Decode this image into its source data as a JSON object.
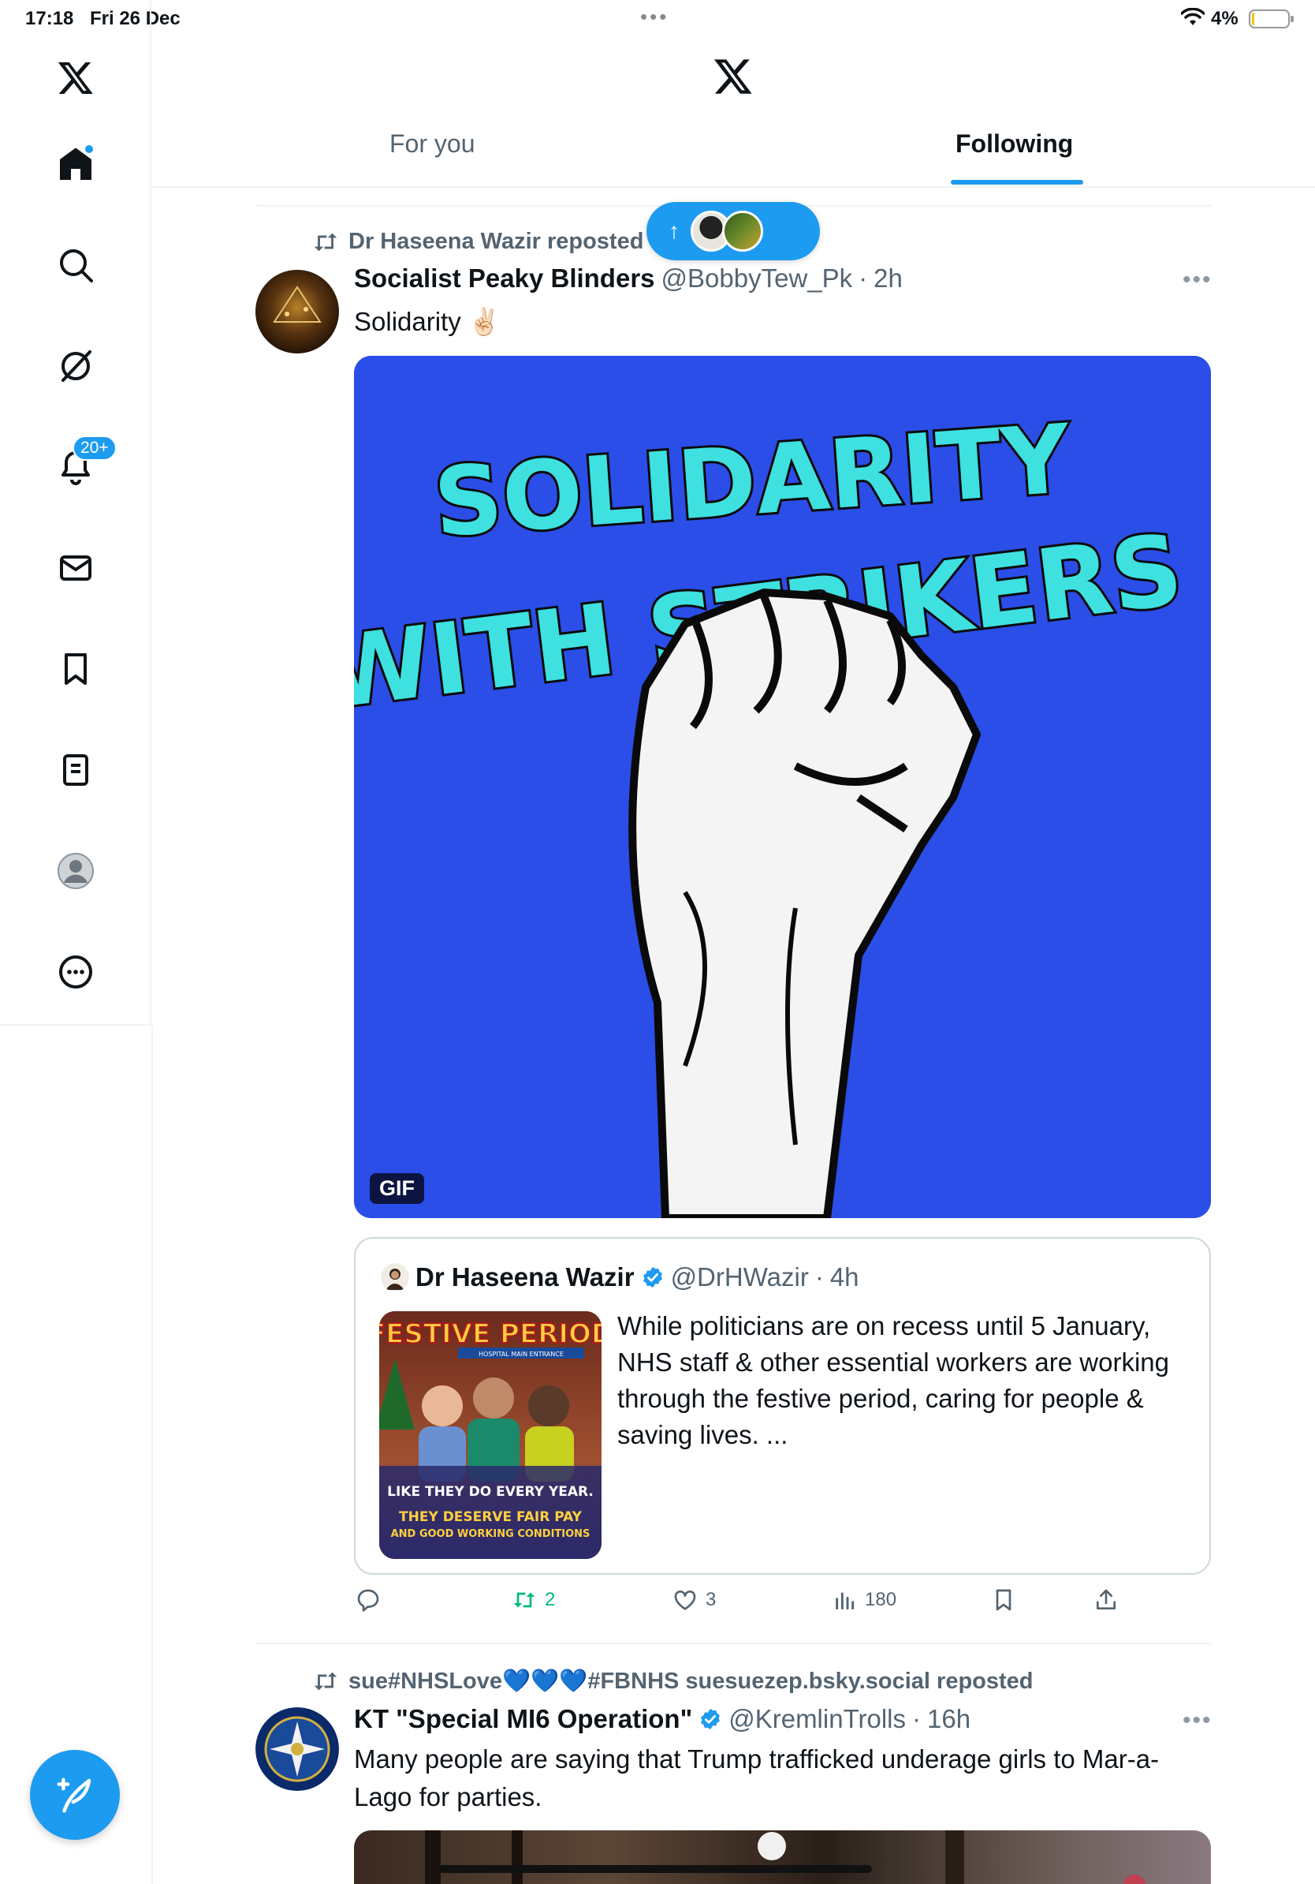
{
  "status": {
    "time": "17:18",
    "date": "Fri 26 Dec",
    "battery_pct": "4%",
    "battery_level": 0.04
  },
  "sidebar": {
    "items": [
      {
        "name": "logo",
        "icon": "x-logo-icon"
      },
      {
        "name": "home",
        "icon": "home-icon",
        "dot": true
      },
      {
        "name": "explore",
        "icon": "search-icon"
      },
      {
        "name": "grok",
        "icon": "grok-icon"
      },
      {
        "name": "notifications",
        "icon": "bell-icon",
        "badge": "20+"
      },
      {
        "name": "messages",
        "icon": "mail-icon"
      },
      {
        "name": "bookmarks",
        "icon": "bookmark-icon"
      },
      {
        "name": "lists",
        "icon": "list-icon"
      },
      {
        "name": "profile",
        "icon": "avatar-icon"
      },
      {
        "name": "more",
        "icon": "more-circle-icon"
      }
    ],
    "compose_icon": "compose-feather-icon"
  },
  "header": {
    "tabs": [
      {
        "label": "For you",
        "active": false
      },
      {
        "label": "Following",
        "active": true
      }
    ]
  },
  "new_posts_pill": {
    "icon": "arrow-up-icon"
  },
  "posts": [
    {
      "repost_by": "Dr Haseena Wazir reposted",
      "name": "Socialist Peaky Blinders",
      "handle": "@BobbyTew_Pk",
      "time": "2h",
      "text": "Solidarity ✌🏻",
      "media": {
        "badge": "GIF",
        "line1": "SOLIDARITY",
        "line2": "WITH STRIKERS"
      },
      "quote": {
        "name": "Dr Haseena Wazir",
        "handle": "@DrHWazir",
        "time": "4h",
        "text": "While politicians are on recess until 5 January, NHS staff & other essential workers are working through the festive period, caring for people & saving lives. ...",
        "image_text": {
          "title": "FESTIVE PERIOD",
          "sign": "HOSPITAL MAIN ENTRANCE",
          "line1": "LIKE THEY DO EVERY YEAR.",
          "line2": "THEY DESERVE FAIR PAY",
          "line3": "AND GOOD WORKING CONDITIONS"
        }
      },
      "stats": {
        "replies": "",
        "reposts": "2",
        "likes": "3",
        "views": "180"
      }
    },
    {
      "repost_by": "sue#NHSLove💙💙💙#FBNHS suesuezep.bsky.social reposted",
      "name": "KT \"Special MI6 Operation\"",
      "handle": "@KremlinTrolls",
      "time": "16h",
      "text": "Many people are saying that Trump trafficked underage girls to Mar-a-Lago for parties."
    }
  ],
  "colors": {
    "accent": "#1d9bf0",
    "text": "#0f1419",
    "muted": "#536471",
    "retweet": "#00ba7c",
    "gif_bg": "#2b4ee8",
    "gif_text": "#3ee0e0"
  }
}
